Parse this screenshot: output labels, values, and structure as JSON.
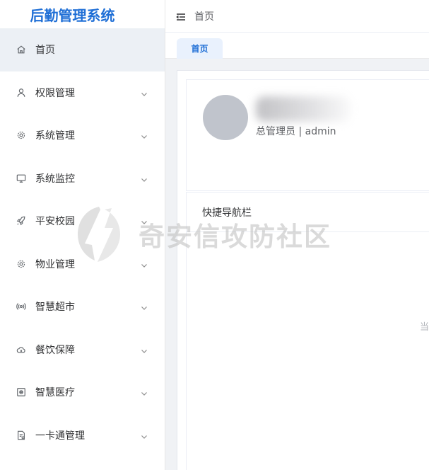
{
  "brand": {
    "title": "后勤管理系统"
  },
  "sidebar": {
    "items": [
      {
        "label": "首页",
        "icon": "home-icon",
        "active": true
      },
      {
        "label": "权限管理",
        "icon": "user-icon",
        "expandable": true
      },
      {
        "label": "系统管理",
        "icon": "gear-icon",
        "expandable": true
      },
      {
        "label": "系统监控",
        "icon": "monitor-icon",
        "expandable": true
      },
      {
        "label": "平安校园",
        "icon": "rocket-icon",
        "expandable": true
      },
      {
        "label": "物业管理",
        "icon": "gear-icon",
        "expandable": true
      },
      {
        "label": "智慧超市",
        "icon": "broadcast-icon",
        "expandable": true
      },
      {
        "label": "餐饮保障",
        "icon": "cloud-icon",
        "expandable": true
      },
      {
        "label": "智慧医疗",
        "icon": "medical-box-icon",
        "expandable": true
      },
      {
        "label": "一卡通管理",
        "icon": "card-document-icon",
        "expandable": true
      }
    ]
  },
  "header": {
    "breadcrumb": "首页"
  },
  "tabs": [
    {
      "label": "首页",
      "active": true
    }
  ],
  "user_card": {
    "role": "总管理员 | admin"
  },
  "quick_nav": {
    "title": "快捷导航栏"
  },
  "edge_text": "当",
  "watermark": {
    "text": "奇安信攻防社区"
  },
  "colors": {
    "accent": "#1f6fd6",
    "active_bg": "#ecf0f5",
    "avatar": "#c0c4cc"
  }
}
